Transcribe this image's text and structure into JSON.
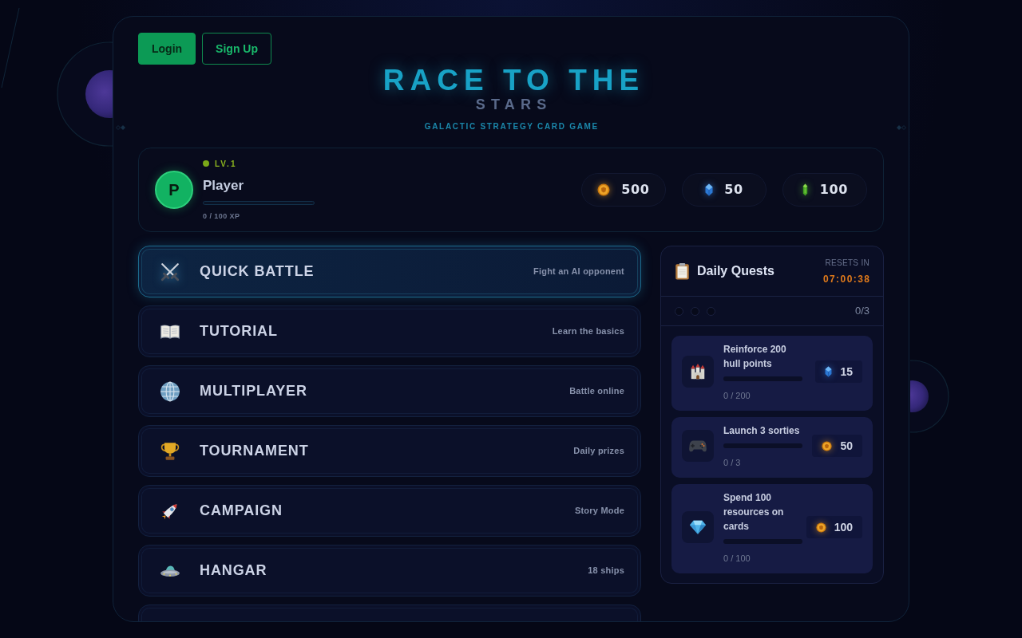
{
  "auth_buttons": [
    {
      "label": "Login",
      "kind": "primary"
    },
    {
      "label": "Sign Up",
      "kind": "outline"
    }
  ],
  "title": {
    "main": "RACE TO THE",
    "sub": "STARS",
    "tagline": "GALACTIC STRATEGY CARD GAME"
  },
  "player": {
    "avatar_letter": "P",
    "level": "LV.1",
    "name": "Player",
    "xp": {
      "level": 0,
      "reading": "0 / 100 XP"
    }
  },
  "currencies": [
    {
      "kind": "coin",
      "amount": "500"
    },
    {
      "kind": "crystal",
      "amount": "50"
    },
    {
      "kind": "energy",
      "amount": "100"
    }
  ],
  "menu": [
    {
      "title": "QUICK BATTLE",
      "subtitle": "Fight an AI opponent",
      "selected": true
    },
    {
      "title": "TUTORIAL",
      "subtitle": "Learn the basics",
      "selected": false
    },
    {
      "title": "MULTIPLAYER",
      "subtitle": "Battle online",
      "selected": false
    },
    {
      "title": "TOURNAMENT",
      "subtitle": "Daily prizes",
      "selected": false
    },
    {
      "title": "CAMPAIGN",
      "subtitle": "Story Mode",
      "selected": false
    },
    {
      "title": "HANGAR",
      "subtitle": "18 ships",
      "selected": false
    }
  ],
  "daily_quests": {
    "title": "Daily Quests",
    "resets_label": "RESETS IN",
    "resets_time": "07:00:38",
    "progress_dots": [
      {
        "filled": false
      },
      {
        "filled": false
      },
      {
        "filled": false
      }
    ],
    "progress_count": "0/3",
    "quests": [
      {
        "title": "Reinforce 200 hull points",
        "level": 0,
        "progress": "0 / 200",
        "reward": {
          "kind": "crystal",
          "amount": "15"
        }
      },
      {
        "title": "Launch 3 sorties",
        "level": 0,
        "progress": "0 / 3",
        "reward": {
          "kind": "coin",
          "amount": "50"
        }
      },
      {
        "title": "Spend 100 resources on cards",
        "level": 0,
        "progress": "0 / 100",
        "reward": {
          "kind": "coin",
          "amount": "100"
        }
      }
    ]
  }
}
